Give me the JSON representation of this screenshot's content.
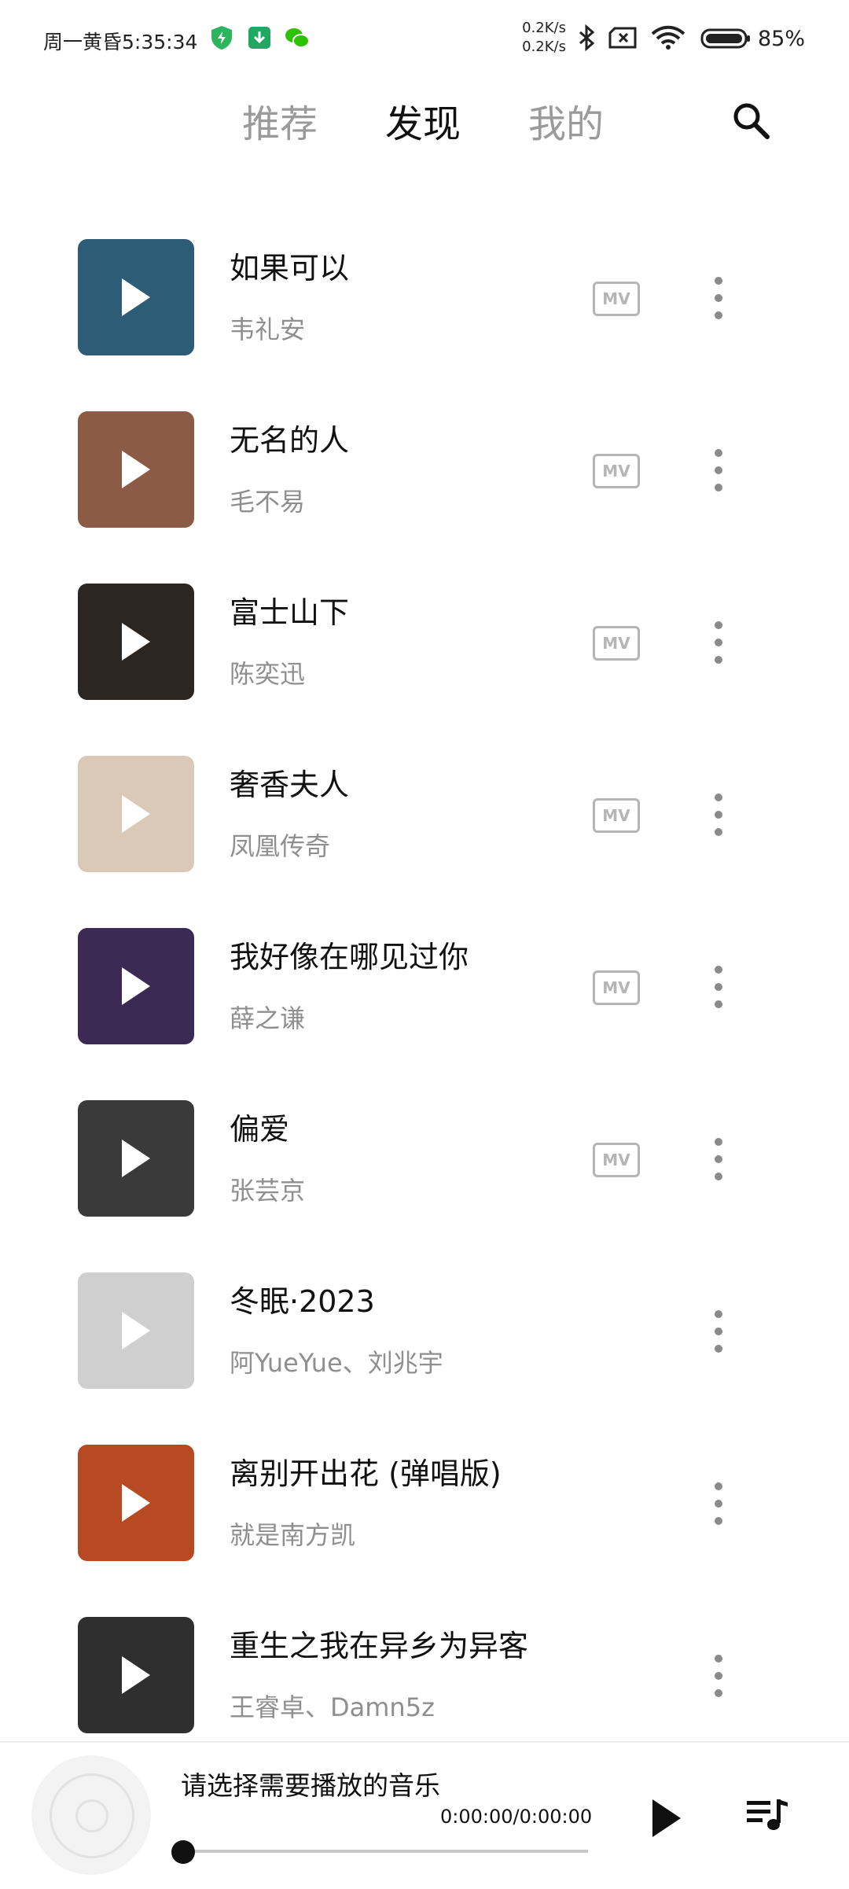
{
  "status_bar": {
    "time": "周一黄昏5:35:34",
    "net_up": "0.2K/s",
    "net_down": "0.2K/s",
    "battery": "85%"
  },
  "tabs": [
    {
      "label": "推荐",
      "active": false
    },
    {
      "label": "发现",
      "active": true
    },
    {
      "label": "我的",
      "active": false
    }
  ],
  "songs": [
    {
      "title": "如果可以",
      "artist": "韦礼安",
      "mv": true,
      "cover_color": "#2d5c77"
    },
    {
      "title": "无名的人",
      "artist": "毛不易",
      "mv": true,
      "cover_color": "#8c5b46"
    },
    {
      "title": "富士山下",
      "artist": "陈奕迅",
      "mv": true,
      "cover_color": "#2b2622"
    },
    {
      "title": "奢香夫人",
      "artist": "凤凰传奇",
      "mv": true,
      "cover_color": "#d9c9b6"
    },
    {
      "title": "我好像在哪见过你",
      "artist": "薛之谦",
      "mv": true,
      "cover_color": "#3b2a54"
    },
    {
      "title": "偏爱",
      "artist": "张芸京",
      "mv": true,
      "cover_color": "#3a3a3a"
    },
    {
      "title": "冬眠·2023",
      "artist": "阿YueYue、刘兆宇",
      "mv": false,
      "cover_color": "#cfcfcf"
    },
    {
      "title": "离别开出花 (弹唱版)",
      "artist": "就是南方凯",
      "mv": false,
      "cover_color": "#b74a22"
    },
    {
      "title": "重生之我在异乡为异客",
      "artist": "王睿卓、Damn5z",
      "mv": false,
      "cover_color": "#2f2f2f"
    }
  ],
  "mv_label": "MV",
  "player": {
    "title": "请选择需要播放的音乐",
    "time": "0:00:00/0:00:00",
    "progress": 0
  }
}
